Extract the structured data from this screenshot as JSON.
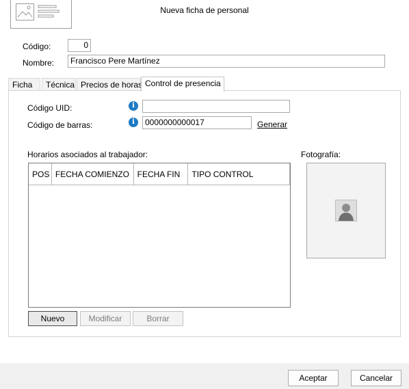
{
  "window": {
    "title": "Nueva ficha de personal"
  },
  "header": {
    "image_placeholder_icon": "image-card-icon"
  },
  "form": {
    "codigo": {
      "label": "Código:",
      "value": "0"
    },
    "nombre": {
      "label": "Nombre:",
      "value": "Francisco Pere Martínez"
    }
  },
  "tabs": [
    {
      "label": "Ficha",
      "active": false
    },
    {
      "label": "Técnica",
      "active": false
    },
    {
      "label": "Precios de horas",
      "active": false
    },
    {
      "label": "Control de presencia",
      "active": true
    }
  ],
  "presencia": {
    "uid": {
      "label": "Código UID:",
      "value": "",
      "info_icon": "info-icon"
    },
    "barras": {
      "label": "Código de barras:",
      "value": "0000000000017",
      "info_icon": "info-icon",
      "generate_link": "Generar"
    },
    "horarios": {
      "label": "Horarios asociados al trabajador:",
      "columns": [
        "POS",
        "FECHA COMIENZO",
        "FECHA FIN",
        "TIPO CONTROL"
      ],
      "rows": []
    },
    "foto": {
      "label": "Fotografía:",
      "icon": "person-photo-icon"
    },
    "buttons": {
      "nuevo": "Nuevo",
      "modificar": "Modificar",
      "borrar": "Borrar"
    }
  },
  "footer": {
    "accept": "Aceptar",
    "cancel": "Cancelar"
  },
  "colors": {
    "info_blue": "#1e7ac4",
    "footer_bg": "#f0f0f0"
  }
}
